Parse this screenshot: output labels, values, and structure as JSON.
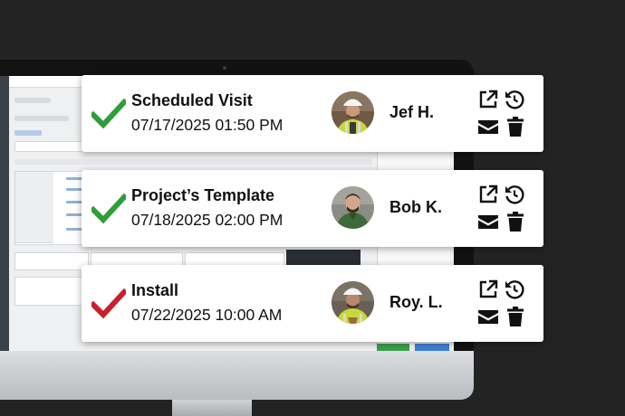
{
  "theme": {
    "check_green": "#2f9e3a",
    "check_red": "#c8202c",
    "icon_color": "#111111",
    "card_bg": "#ffffff",
    "page_bg": "#232323"
  },
  "icons": {
    "open": "external-link-icon",
    "history": "history-icon",
    "mail": "envelope-icon",
    "delete": "trash-icon"
  },
  "appointments": [
    {
      "title": "Scheduled Visit",
      "datetime": "07/17/2025 01:50 PM",
      "assignee": "Jef H.",
      "status": "green-check",
      "avatar": "hard-hat-safety-vest"
    },
    {
      "title": "Project’s Template",
      "datetime": "07/18/2025 02:00 PM",
      "assignee": "Bob K.",
      "status": "green-check",
      "avatar": "green-shirt"
    },
    {
      "title": "Install",
      "datetime": "07/22/2025 10:00 AM",
      "assignee": "Roy. L.",
      "status": "red-check",
      "avatar": "hard-hat-safety-vest"
    }
  ]
}
